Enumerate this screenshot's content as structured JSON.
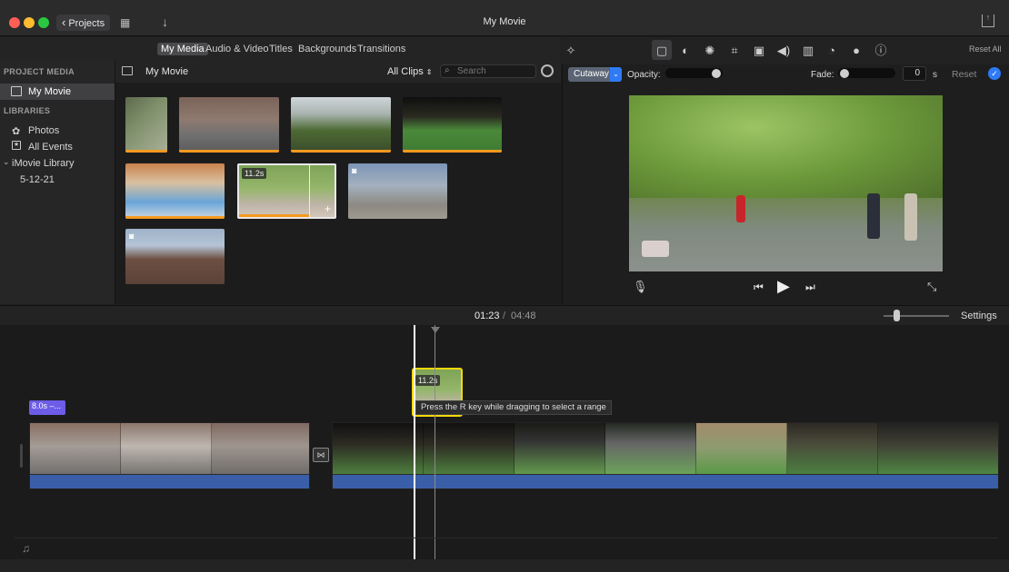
{
  "window": {
    "title": "My Movie",
    "projects_label": "Projects"
  },
  "tabs": [
    {
      "label": "My Media",
      "active": true
    },
    {
      "label": "Audio & Video"
    },
    {
      "label": "Titles"
    },
    {
      "label": "Backgrounds"
    },
    {
      "label": "Transitions"
    }
  ],
  "sidebar": {
    "project_media_header": "PROJECT MEDIA",
    "project_item": "My Movie",
    "libraries_header": "LIBRARIES",
    "items": [
      "Photos",
      "All Events",
      "iMovie Library",
      "5-12-21"
    ]
  },
  "browser": {
    "title": "My Movie",
    "filter": "All Clips",
    "search_placeholder": "Search",
    "clip_badge": "11.2s"
  },
  "viewer": {
    "reset_all": "Reset All",
    "overlay_mode": "Cutaway",
    "opacity_label": "Opacity:",
    "fade_label": "Fade:",
    "fade_value": "0",
    "fade_unit": "s",
    "reset_label": "Reset"
  },
  "timeline": {
    "current_time": "01:23",
    "separator": "/",
    "total_time": "04:48",
    "settings_label": "Settings",
    "title_clip_label": "8.0s –...",
    "cutaway_badge": "11.2s",
    "tooltip": "Press the R key while dragging to select a range"
  },
  "colors": {
    "accent": "#2f7bf6",
    "clip_orange": "#f49a1f",
    "audio_blue": "#3a5fa8",
    "title_purple": "#6c5ce7",
    "selection_yellow": "#f5d90a"
  }
}
